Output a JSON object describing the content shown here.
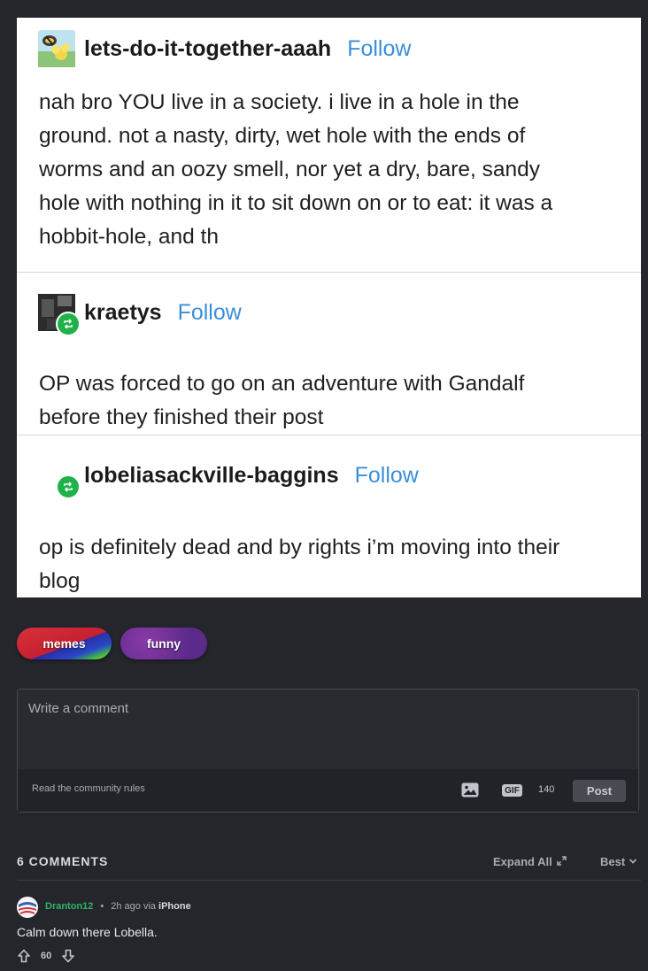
{
  "post_image": {
    "blocks": [
      {
        "username": "lets-do-it-together-aaah",
        "follow": "Follow",
        "lines": [
          "nah bro YOU live in a society. i live in a hole in the",
          "ground. not a nasty, dirty, wet hole with the ends of",
          "worms and an oozy smell, nor yet a dry, bare, sandy",
          "hole with nothing in it to sit down on or to eat: it was a",
          "hobbit-hole, and th"
        ]
      },
      {
        "username": "kraetys",
        "follow": "Follow",
        "lines": [
          "OP was forced to go on an adventure with Gandalf",
          "before they finished their post"
        ]
      },
      {
        "username": "lobeliasackville-baggins",
        "follow": "Follow",
        "lines": [
          "op is definitely dead and by rights i’m moving into their",
          "blog"
        ]
      }
    ]
  },
  "tags": [
    "memes",
    "funny"
  ],
  "comment_form": {
    "placeholder": "Write a comment",
    "rules_link": "Read the community rules",
    "gif_label": "GIF",
    "char_count": "140",
    "post_label": "Post"
  },
  "comments_header": {
    "count_label": "6 COMMENTS",
    "expand_label": "Expand All",
    "sort_label": "Best"
  },
  "comments": [
    {
      "username": "Dranton12",
      "time": "2h ago via",
      "device": "iPhone",
      "text": "Calm down there Lobella.",
      "score": "60"
    }
  ],
  "colors": {
    "background": "#25262c",
    "follow_link": "#3b8fd9",
    "reblog_green": "#1fb24a",
    "username_green": "#2fb36b"
  }
}
